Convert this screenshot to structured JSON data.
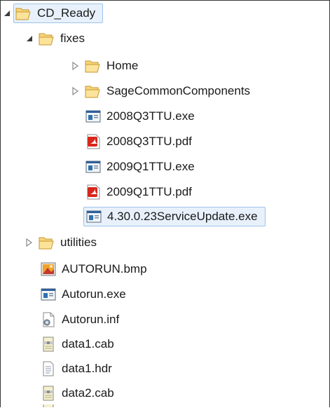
{
  "tree": {
    "root": {
      "label": "CD_Ready",
      "icon": "folder-open-icon",
      "expanded": true
    },
    "fixes": {
      "label": "fixes",
      "icon": "folder-open-icon",
      "expanded": true
    },
    "fixes_children": [
      {
        "label": "Home",
        "icon": "folder-open-icon",
        "type": "folder"
      },
      {
        "label": "SageCommonComponents",
        "icon": "folder-open-icon",
        "type": "folder"
      },
      {
        "label": "2008Q3TTU.exe",
        "icon": "exe-icon",
        "type": "exe"
      },
      {
        "label": "2008Q3TTU.pdf",
        "icon": "pdf-icon",
        "type": "pdf"
      },
      {
        "label": "2009Q1TTU.exe",
        "icon": "exe-icon",
        "type": "exe"
      },
      {
        "label": "2009Q1TTU.pdf",
        "icon": "pdf-icon",
        "type": "pdf"
      },
      {
        "label": "4.30.0.23ServiceUpdate.exe",
        "icon": "exe-icon",
        "type": "exe",
        "selected": true
      }
    ],
    "root_children": [
      {
        "label": "utilities",
        "icon": "folder-open-icon",
        "type": "folder"
      },
      {
        "label": "AUTORUN.bmp",
        "icon": "bmp-icon",
        "type": "bmp"
      },
      {
        "label": "Autorun.exe",
        "icon": "exe-icon",
        "type": "exe"
      },
      {
        "label": "Autorun.inf",
        "icon": "inf-icon",
        "type": "inf"
      },
      {
        "label": "data1.cab",
        "icon": "cab-icon",
        "type": "cab"
      },
      {
        "label": "data1.hdr",
        "icon": "text-file-icon",
        "type": "hdr"
      },
      {
        "label": "data2.cab",
        "icon": "cab-icon",
        "type": "cab"
      }
    ]
  },
  "colors": {
    "selection_bg": "#e8f1fb",
    "selection_border": "#9fc3e8",
    "folder": "#f0c24a",
    "pdf": "#d9261c"
  }
}
